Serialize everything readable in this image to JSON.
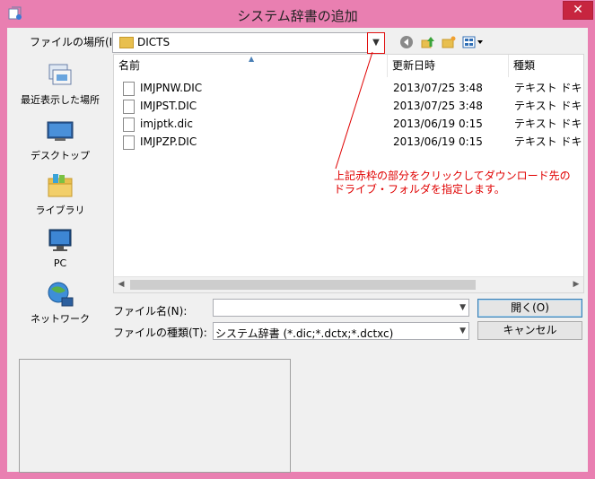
{
  "window": {
    "title": "システム辞書の追加",
    "close_label": "✕"
  },
  "lookin": {
    "label": "ファイルの場所(I):",
    "value": "DICTS",
    "dropdown_glyph": "▼"
  },
  "toolbar": {
    "back_glyph": "◀",
    "up_glyph": "▲",
    "newfolder_glyph": "✱",
    "view_glyph": "▦▾"
  },
  "places": [
    {
      "label": "最近表示した場所"
    },
    {
      "label": "デスクトップ"
    },
    {
      "label": "ライブラリ"
    },
    {
      "label": "PC"
    },
    {
      "label": "ネットワーク"
    }
  ],
  "columns": {
    "name": "名前",
    "date": "更新日時",
    "type": "種類"
  },
  "files": [
    {
      "name": "IMJPNW.DIC",
      "date": "2013/07/25 3:48",
      "type": "テキスト ドキュメント"
    },
    {
      "name": "IMJPST.DIC",
      "date": "2013/07/25 3:48",
      "type": "テキスト ドキュメント"
    },
    {
      "name": "imjptk.dic",
      "date": "2013/06/19 0:15",
      "type": "テキスト ドキュメント"
    },
    {
      "name": "IMJPZP.DIC",
      "date": "2013/06/19 0:15",
      "type": "テキスト ドキュメント"
    }
  ],
  "annotation": {
    "line1": "上記赤枠の部分をクリックしてダウンロード先の",
    "line2": "ドライブ・フォルダを指定します。"
  },
  "filename": {
    "label": "ファイル名(N):",
    "value": ""
  },
  "filetype": {
    "label": "ファイルの種類(T):",
    "value": "システム辞書 (*.dic;*.dctx;*.dctxc)"
  },
  "buttons": {
    "open": "開く(O)",
    "cancel": "キャンセル"
  },
  "colors": {
    "frame": "#e97fb1",
    "annotation": "#e00000"
  }
}
